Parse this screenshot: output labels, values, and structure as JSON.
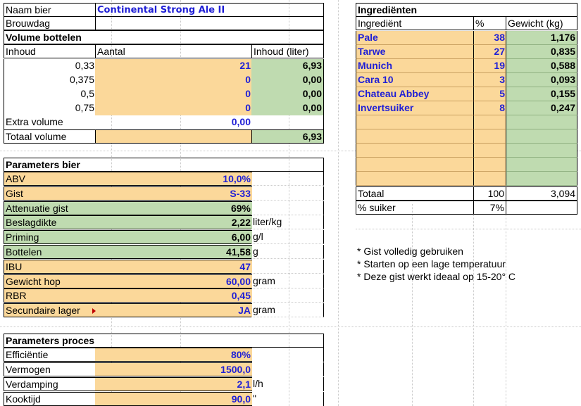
{
  "left": {
    "naam_label": "Naam bier",
    "naam_value": "Continental Strong Ale II",
    "brouwdag_label": "Brouwdag",
    "volume": {
      "title": "Volume bottelen",
      "col_inhoud": "Inhoud",
      "col_aantal": "Aantal",
      "col_liter": "Inhoud (liter)",
      "rows": [
        {
          "inhoud": "0,33",
          "aantal": "21",
          "liter": "6,93"
        },
        {
          "inhoud": "0,375",
          "aantal": "0",
          "liter": "0,00"
        },
        {
          "inhoud": "0,5",
          "aantal": "0",
          "liter": "0,00"
        },
        {
          "inhoud": "0,75",
          "aantal": "0",
          "liter": "0,00"
        }
      ],
      "extra_label": "Extra volume",
      "extra_value": "0,00",
      "totaal_label": "Totaal volume",
      "totaal_value": "6,93"
    },
    "bier": {
      "title": "Parameters bier",
      "rows": [
        {
          "label": "ABV",
          "value": "10,0%",
          "unit": ""
        },
        {
          "label": "Gist",
          "value": "S-33",
          "unit": ""
        },
        {
          "label": "Attenuatie gist",
          "value": "69%",
          "unit": ""
        },
        {
          "label": "Beslagdikte",
          "value": "2,22",
          "unit": "liter/kg"
        },
        {
          "label": "Priming",
          "value": "6,00",
          "unit": "g/l"
        },
        {
          "label": "Bottelen",
          "value": "41,58",
          "unit": "g"
        },
        {
          "label": "IBU",
          "value": "47",
          "unit": ""
        },
        {
          "label": "Gewicht hop",
          "value": "60,00",
          "unit": "gram"
        },
        {
          "label": "RBR",
          "value": "0,45",
          "unit": ""
        },
        {
          "label": "Secundaire lager",
          "value": "JA",
          "unit": "gram"
        }
      ]
    },
    "proces": {
      "title": "Parameters proces",
      "rows": [
        {
          "label": "Efficiëntie",
          "value": "80%",
          "unit": ""
        },
        {
          "label": "Vermogen",
          "value": "1500,0",
          "unit": ""
        },
        {
          "label": "Verdamping",
          "value": "2,1",
          "unit": "l/h"
        },
        {
          "label": "Kooktijd",
          "value": "90,0",
          "unit": "\""
        }
      ]
    }
  },
  "right": {
    "title": "Ingrediënten",
    "col_ingredient": "Ingrediënt",
    "col_pct": "%",
    "col_gewicht": "Gewicht (kg)",
    "rows": [
      {
        "name": "Pale",
        "pct": "38",
        "kg": "1,176"
      },
      {
        "name": "Tarwe",
        "pct": "27",
        "kg": "0,835"
      },
      {
        "name": "Munich",
        "pct": "19",
        "kg": "0,588"
      },
      {
        "name": "Cara 10",
        "pct": "3",
        "kg": "0,093"
      },
      {
        "name": "Chateau Abbey",
        "pct": "5",
        "kg": "0,155"
      },
      {
        "name": "Invertsuiker",
        "pct": "8",
        "kg": "0,247"
      },
      {
        "name": "",
        "pct": "",
        "kg": ""
      },
      {
        "name": "",
        "pct": "",
        "kg": ""
      },
      {
        "name": "",
        "pct": "",
        "kg": ""
      },
      {
        "name": "",
        "pct": "",
        "kg": ""
      },
      {
        "name": "",
        "pct": "",
        "kg": ""
      }
    ],
    "totaal_label": "Totaal",
    "totaal_pct": "100",
    "totaal_kg": "3,094",
    "suiker_label": "% suiker",
    "suiker_pct": "7%",
    "notes": [
      "* Gist volledig gebruiken",
      "* Starten op een lage temperatuur",
      "* Deze gist werkt ideaal op 15-20° C"
    ]
  },
  "colors": {
    "input_fill": "#fbd89a",
    "calc_fill": "#bfdbb0",
    "value_text": "#1f1fd6"
  }
}
